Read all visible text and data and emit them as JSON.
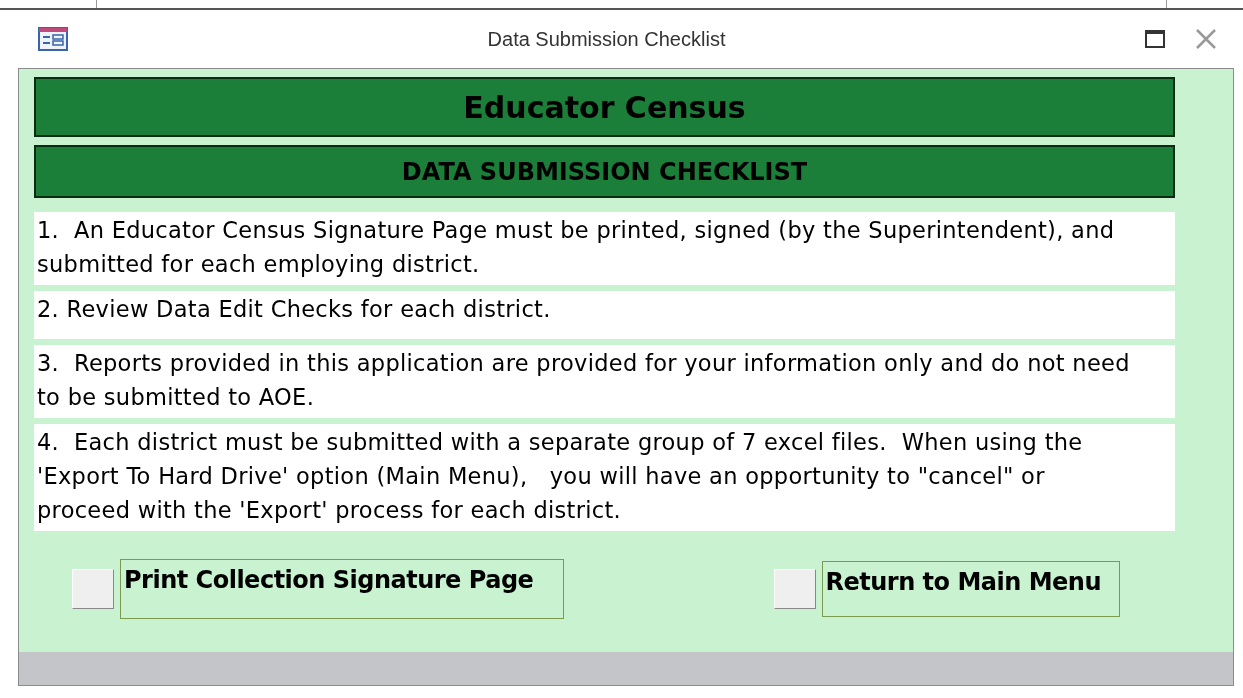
{
  "window": {
    "title": "Data Submission Checklist"
  },
  "headers": [
    {
      "kind": "title",
      "text": "Educator Census"
    },
    {
      "kind": "subtitle",
      "text": "DATA SUBMISSION CHECKLIST"
    }
  ],
  "items": [
    {
      "text": "1.  An Educator Census Signature Page must be printed, signed (by the Superintendent), and submitted for each employing district."
    },
    {
      "text": "2. Review Data Edit Checks for each district."
    },
    {
      "text": "3.  Reports provided in this application are provided for your information only and do not need to be submitted to AOE."
    },
    {
      "text": "4.  Each district must be submitted with a separate group of 7 excel files.  When using the 'Export To Hard Drive' option (Main Menu),   you will have an opportunity to \"cancel\" or proceed with the 'Export' process for each district."
    }
  ],
  "buttons": [
    {
      "label": "Print Collection Signature Page"
    },
    {
      "label": "Return to Main Menu"
    }
  ]
}
